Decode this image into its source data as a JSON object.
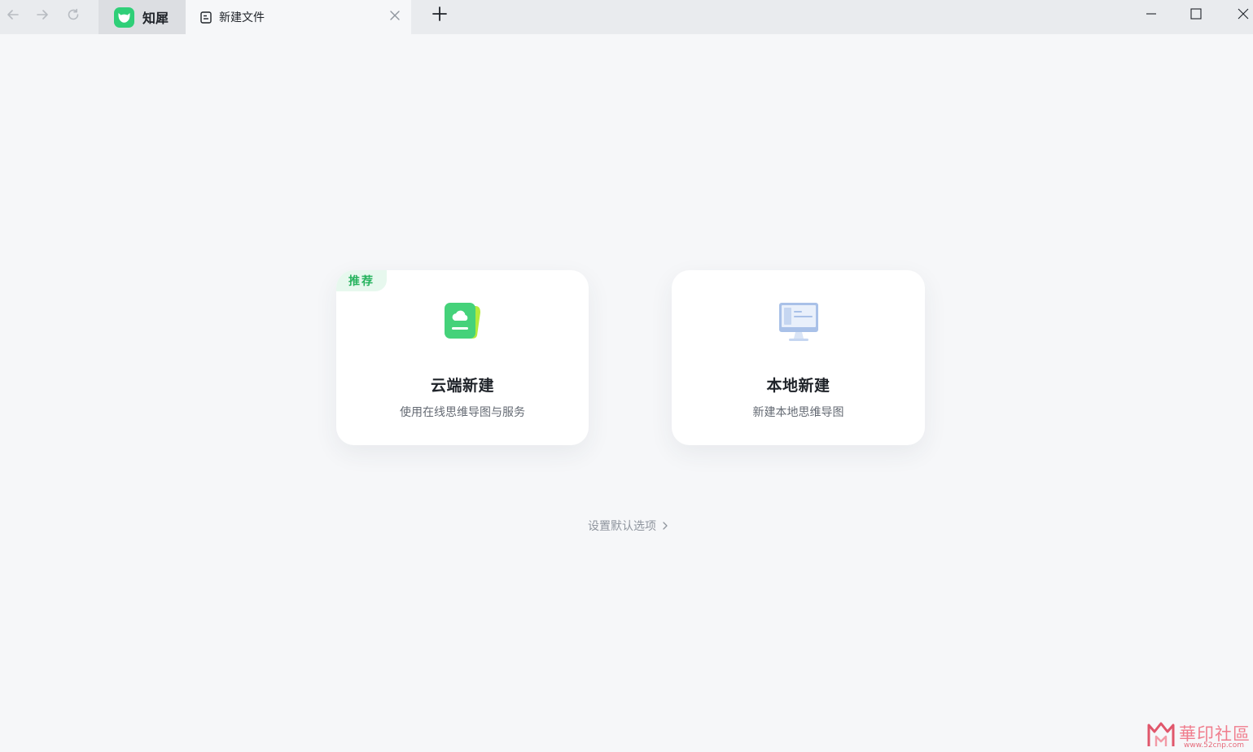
{
  "titlebar": {
    "home_tab_label": "知犀",
    "active_tab_label": "新建文件",
    "icons": {
      "back": "arrow-left-icon",
      "forward": "arrow-right-icon",
      "reload": "reload-icon",
      "close_tab": "close-icon",
      "new_tab": "plus-icon",
      "minimize": "minimize-icon",
      "maximize": "maximize-icon",
      "close_window": "close-icon"
    }
  },
  "main": {
    "cloud_card": {
      "badge": "推荐",
      "title": "云端新建",
      "description": "使用在线思维导图与服务",
      "icon": "cloud-folder-icon"
    },
    "local_card": {
      "title": "本地新建",
      "description": "新建本地思维导图",
      "icon": "monitor-icon"
    },
    "settings_link": "设置默认选项"
  },
  "watermark": {
    "text": "華印社區",
    "url": "www.52cnp.com"
  },
  "colors": {
    "brand_green": "#2fcf78",
    "badge_text": "#27b35e",
    "badge_bg": "#e7f8ee",
    "page_bg": "#f6f7f9",
    "titlebar_bg": "#e9ebee"
  }
}
